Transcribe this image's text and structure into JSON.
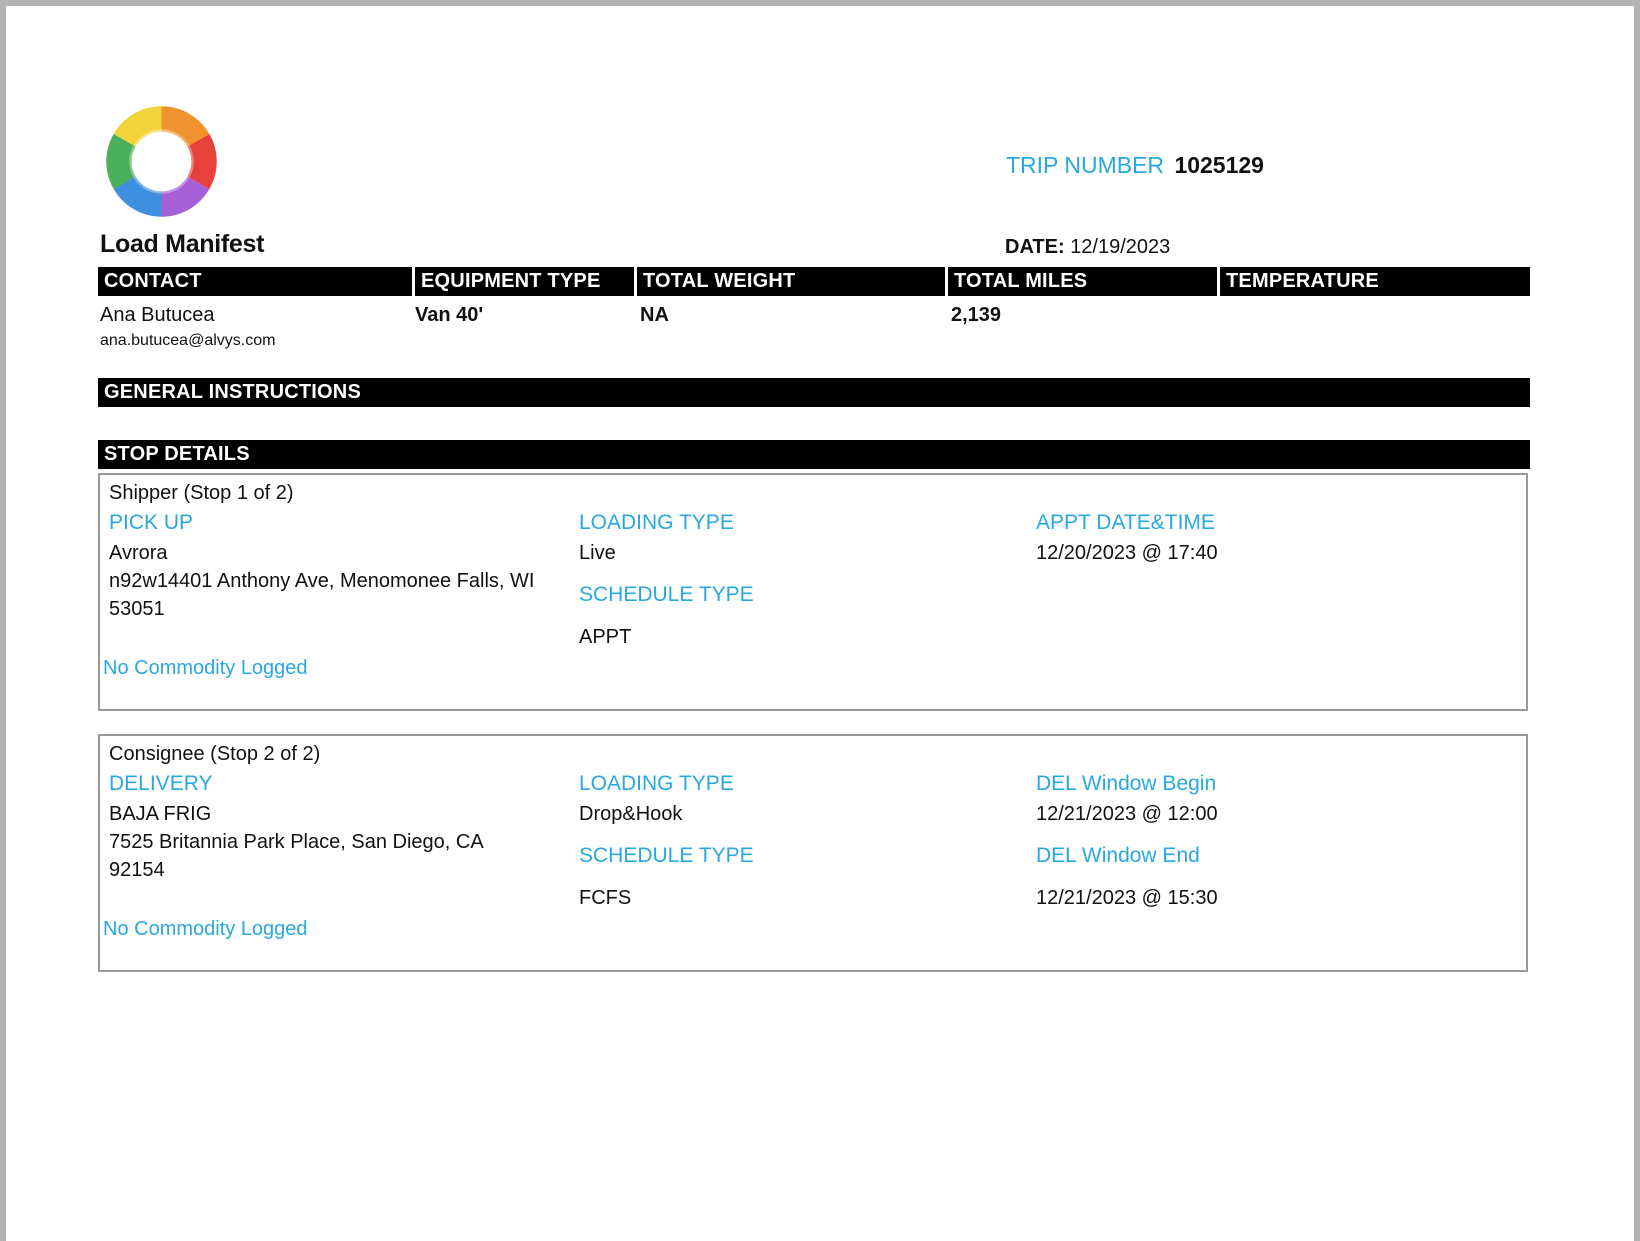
{
  "header": {
    "title": "Load Manifest",
    "trip_label": "TRIP NUMBER",
    "trip_number": "1025129",
    "date_label": "DATE:",
    "date_value": "12/19/2023"
  },
  "summary": {
    "columns": [
      "CONTACT",
      "EQUIPMENT TYPE",
      "TOTAL WEIGHT",
      "TOTAL MILES",
      "TEMPERATURE"
    ],
    "contact_name": "Ana Butucea",
    "contact_email": "ana.butucea@alvys.com",
    "equipment_type": "Van 40'",
    "total_weight": "NA",
    "total_miles": "2,139"
  },
  "general_instructions": {
    "title": "GENERAL INSTRUCTIONS"
  },
  "stop_details": {
    "title": "STOP DETAILS",
    "stops": [
      {
        "heading": "Shipper (Stop 1 of 2)",
        "type_label": "PICK UP",
        "name": "Avrora",
        "address_line1": "n92w14401 Anthony Ave, Menomonee Falls, WI",
        "address_line2": "53051",
        "commodity": "No Commodity Logged",
        "loading_type_label": "LOADING TYPE",
        "loading_type": "Live",
        "schedule_type_label": "SCHEDULE TYPE",
        "schedule_type": "APPT",
        "time_label_1": "APPT DATE&TIME",
        "time_value_1": "12/20/2023 @ 17:40"
      },
      {
        "heading": "Consignee (Stop 2 of 2)",
        "type_label": "DELIVERY",
        "name": "BAJA FRIG",
        "address_line1": "7525 Britannia Park Place, San Diego, CA",
        "address_line2": "92154",
        "commodity": "No Commodity Logged",
        "loading_type_label": "LOADING TYPE",
        "loading_type": "Drop&Hook",
        "schedule_type_label": "SCHEDULE TYPE",
        "schedule_type": "FCFS",
        "time_label_1": "DEL Window Begin",
        "time_value_1": "12/21/2023 @ 12:00",
        "time_label_2": "DEL Window End",
        "time_value_2": "12/21/2023 @ 15:30"
      }
    ]
  },
  "colors": {
    "accent_blue": "#29a8e0",
    "header_bar": "#000000"
  }
}
